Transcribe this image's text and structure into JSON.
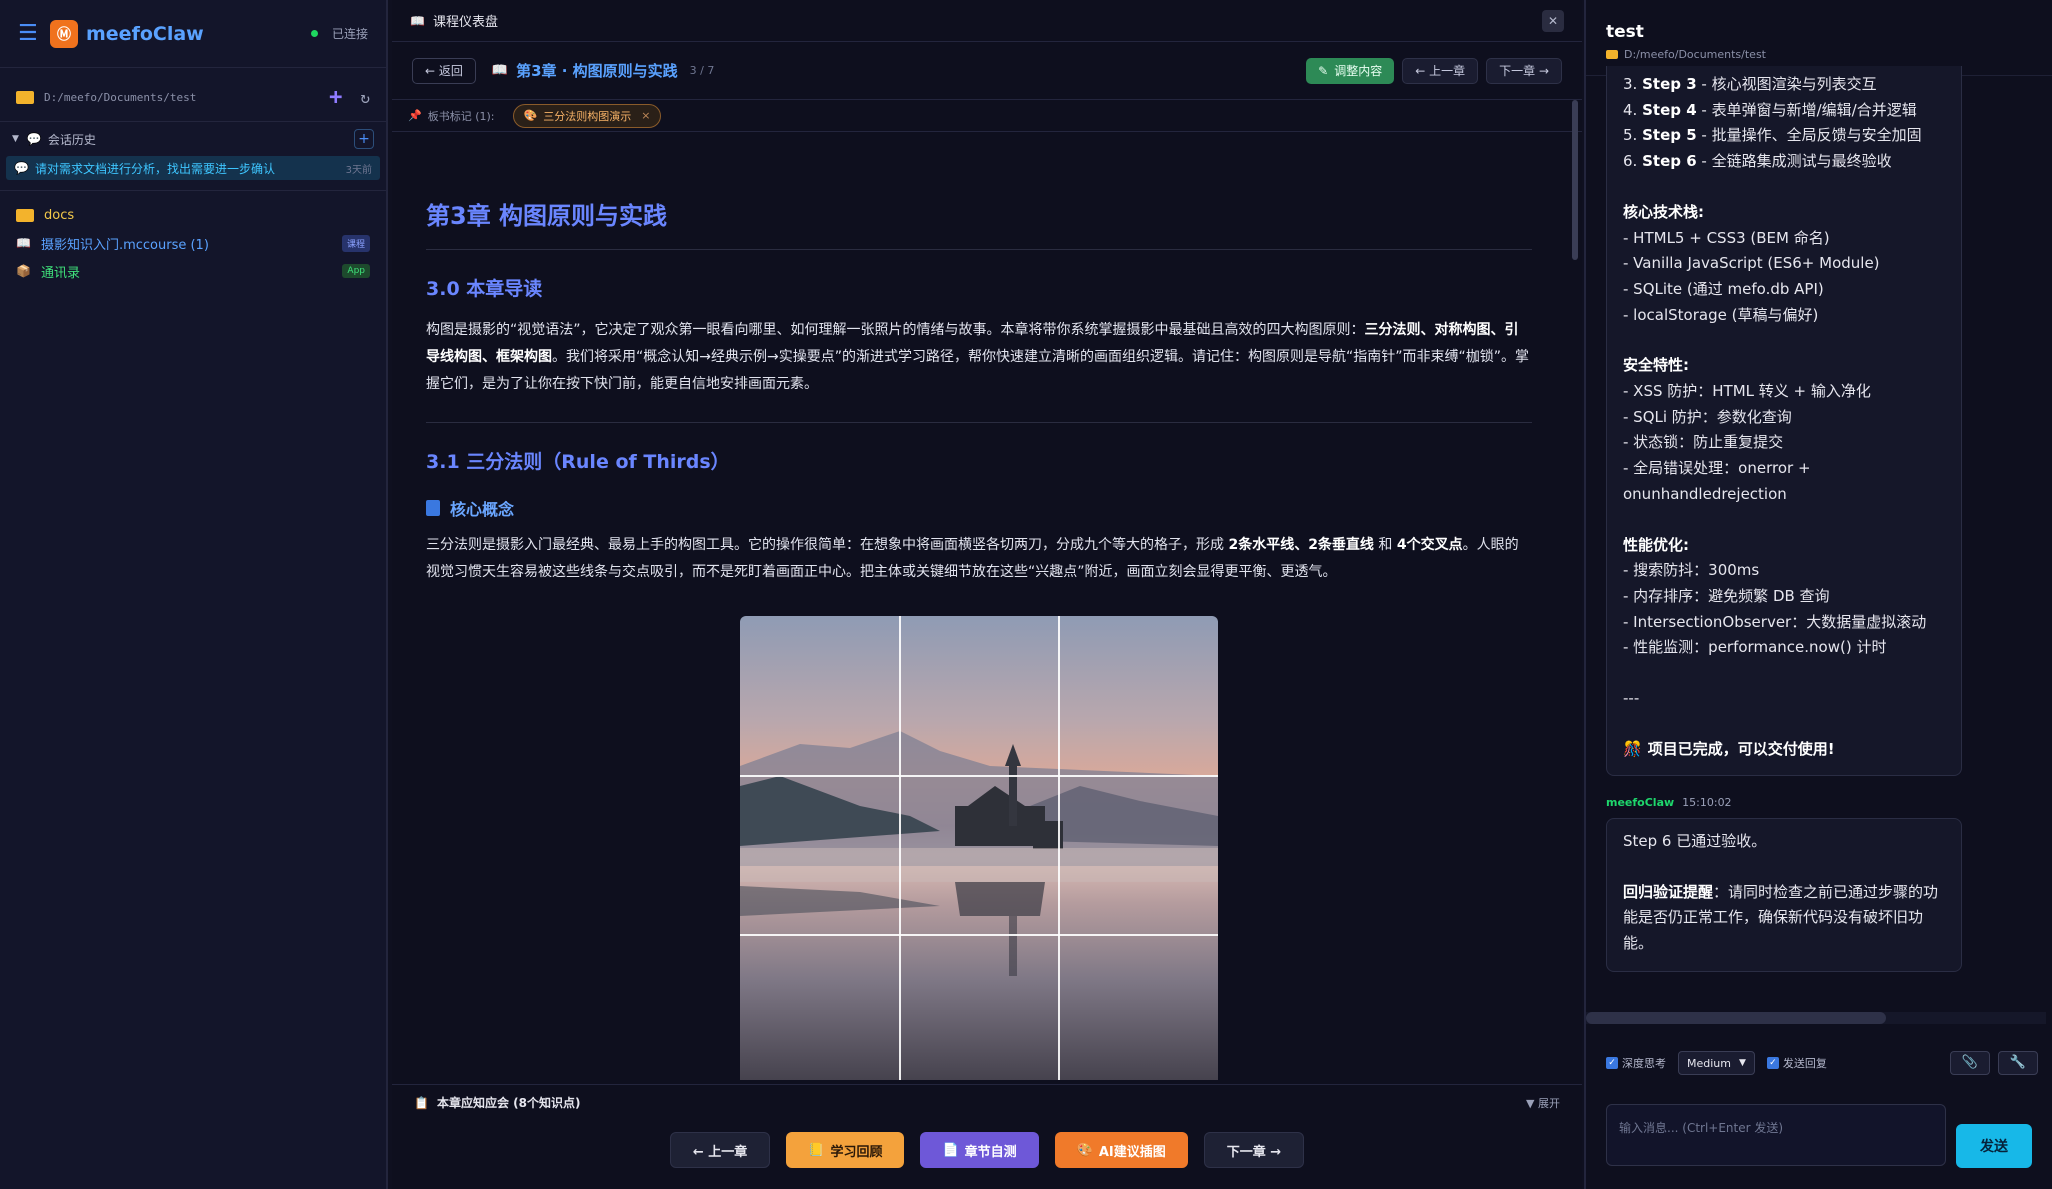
{
  "sidebar": {
    "brand": "meefoClaw",
    "status": "已连接",
    "path": "D:/meefo/Documents/test",
    "history_title": "会话历史",
    "history_items": [
      {
        "label": "请对需求文档进行分析，找出需要进一步确认",
        "time": "3天前"
      }
    ],
    "files": [
      {
        "label": "docs",
        "tag": ""
      },
      {
        "label": "摄影知识入门.mccourse (1)",
        "tag": "课程"
      },
      {
        "label": "通讯录",
        "tag": "App"
      }
    ]
  },
  "main": {
    "tab_title": "课程仪表盘",
    "back_label": "← 返回",
    "chapter_title": "第3章 · 构图原则与实践",
    "chapter_progress": "3 / 7",
    "adjust_label": "调整内容",
    "prev_label": "← 上一章",
    "next_label": "下一章 →",
    "marks_label": "板书标记 (1):",
    "mark_chip": "三分法则构图演示",
    "h1": "第3章 构图原则与实践",
    "s30_title": "3.0 本章导读",
    "s30_p1": "构图是摄影的“视觉语法”，它决定了观众第一眼看向哪里、如何理解一张照片的情绪与故事。本章将带你系统掌握摄影中最基础且高效的四大构图原则：",
    "s30_b1": "三分法则、对称构图、引导线构图、框架构图",
    "s30_p2": "。我们将采用“概念认知→经典示例→实操要点”的渐进式学习路径，帮你快速建立清晰的画面组织逻辑。请记住：构图原则是导航“指南针”而非束缚“枷锁”。掌握它们，是为了让你在按下快门前，能更自信地安排画面元素。",
    "s31_title": "3.1 三分法则（Rule of Thirds）",
    "core_title": "核心概念",
    "s31_p1": "三分法则是摄影入门最经典、最易上手的构图工具。它的操作很简单：在想象中将画面横竖各切两刀，分成九个等大的格子，形成 ",
    "s31_b1": "2条水平线、2条垂直线",
    "s31_p2": " 和 ",
    "s31_b2": "4个交叉点",
    "s31_p3": "。人眼的视觉习惯天生容易被这些线条与交点吸引，而不是死盯着画面正中心。把主体或关键细节放在这些“兴趣点”附近，画面立刻会显得更平衡、更透气。",
    "kp_label": "本章应知应会 (8个知识点)",
    "kp_expand": "▼ 展开",
    "bottom_buttons": [
      "← 上一章",
      "学习回顾",
      "章节自测",
      "AI建议插图",
      "下一章 →"
    ]
  },
  "right": {
    "title": "test",
    "path": "D:/meefo/Documents/test",
    "msg1_lines": [
      {
        "pre": "3. ",
        "b": "Step 3",
        "post": " - 核心视图渲染与列表交互"
      },
      {
        "pre": "4. ",
        "b": "Step 4",
        "post": " - 表单弹窗与新增/编辑/合并逻辑"
      },
      {
        "pre": "5. ",
        "b": "Step 5",
        "post": " - 批量操作、全局反馈与安全加固"
      },
      {
        "pre": "6. ",
        "b": "Step 6",
        "post": " - 全链路集成测试与最终验收"
      }
    ],
    "tech_title": "核心技术栈:",
    "tech_items": [
      "- HTML5 + CSS3 (BEM 命名)",
      "- Vanilla JavaScript (ES6+ Module)",
      "- SQLite (通过 mefo.db API)",
      "- localStorage (草稿与偏好)"
    ],
    "sec_title": "安全特性:",
    "sec_items": [
      "- XSS 防护：HTML 转义 + 输入净化",
      "- SQLi 防护：参数化查询",
      "- 状态锁：防止重复提交",
      "- 全局错误处理：onerror +",
      "onunhandledrejection"
    ],
    "perf_title": "性能优化:",
    "perf_items": [
      "- 搜索防抖：300ms",
      "- 内存排序：避免频繁 DB 查询",
      "- IntersectionObserver：大数据量虚拟滚动",
      "- 性能监测：performance.now() 计时"
    ],
    "divider": "---",
    "done": "项目已完成，可以交付使用!",
    "sender": "meefoClaw",
    "sender_time": "15:10:02",
    "msg2_line1": "Step 6 已通过验收。",
    "msg2_bold": "回归验证提醒",
    "msg2_rest": "：请同时检查之前已通过步骤的功能是否仍正常工作，确保新代码没有破坏旧功能。",
    "opt_think": "深度思考",
    "opt_level": "Medium",
    "opt_send": "发送回复",
    "input_placeholder": "输入消息... (Ctrl+Enter 发送)",
    "send_label": "发送"
  }
}
